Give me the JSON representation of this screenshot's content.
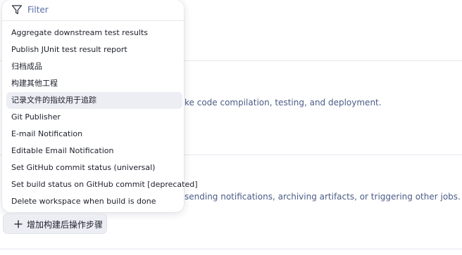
{
  "background": {
    "desc1": "ke code compilation, testing, and deployment.",
    "desc2": "sending notifications, archiving artifacts, or triggering other jobs."
  },
  "filter": {
    "placeholder": "Filter",
    "icon": "filter-icon"
  },
  "menu": {
    "items": [
      "Aggregate downstream test results",
      "Publish JUnit test result report",
      "归档成品",
      "构建其他工程",
      "记录文件的指纹用于追踪",
      "Git Publisher",
      "E-mail Notification",
      "Editable Email Notification",
      "Set GitHub commit status (universal)",
      "Set build status on GitHub commit [deprecated]",
      "Delete workspace when build is done"
    ],
    "highlighted_index": 4
  },
  "add_button": {
    "label": "增加构建后操作步骤",
    "icon": "plus-icon"
  },
  "colors": {
    "link_text": "#4a5c86",
    "placeholder": "#5a6fa8",
    "hover_bg": "#eceef3"
  }
}
